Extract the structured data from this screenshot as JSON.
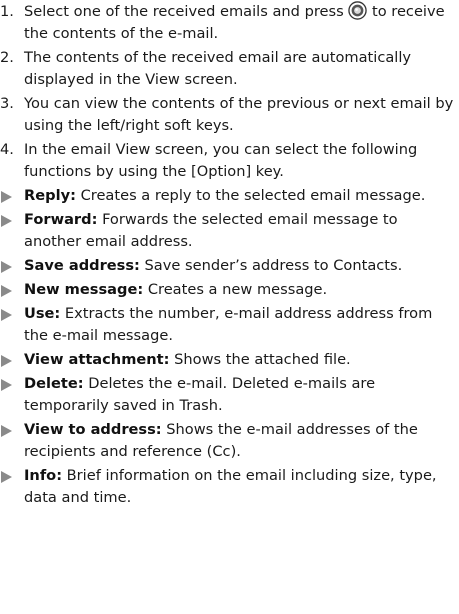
{
  "steps": [
    {
      "num": "1.",
      "text_a": "Select one of the received emails and press",
      "icon": "ok-key-icon",
      "text_b": "to receive the contents of the e-mail."
    },
    {
      "num": "2.",
      "text": "The contents of the received email are automatically displayed in the View screen."
    },
    {
      "num": "3.",
      "text": "You can view the contents of the previous or next email by using the left/right soft keys."
    },
    {
      "num": "4.",
      "text": "In the email View screen, you can select the following functions by using the [Option] key."
    }
  ],
  "options": [
    {
      "term": "Reply:",
      "desc": "Creates a reply to the selected email message."
    },
    {
      "term": "Forward:",
      "desc": "Forwards the selected email message to another email address."
    },
    {
      "term": "Save address:",
      "desc": "Save sender’s address to Contacts."
    },
    {
      "term": "New message:",
      "desc": "Creates a new message."
    },
    {
      "term": "Use:",
      "desc": "Extracts the number, e-mail address address from the e-mail message."
    },
    {
      "term": "View attachment:",
      "desc": "Shows the attached file."
    },
    {
      "term": "Delete:",
      "desc": "Deletes the e-mail. Deleted e-mails are temporarily saved in Trash."
    },
    {
      "term": "View to address:",
      "desc": "Shows the e-mail addresses of the recipients and reference (Cc)."
    },
    {
      "term": "Info:",
      "desc": "Brief information on the email including size, type, data and time."
    }
  ],
  "colors": {
    "text": "#1a1a1a",
    "bullet": "#8a8a8a"
  }
}
